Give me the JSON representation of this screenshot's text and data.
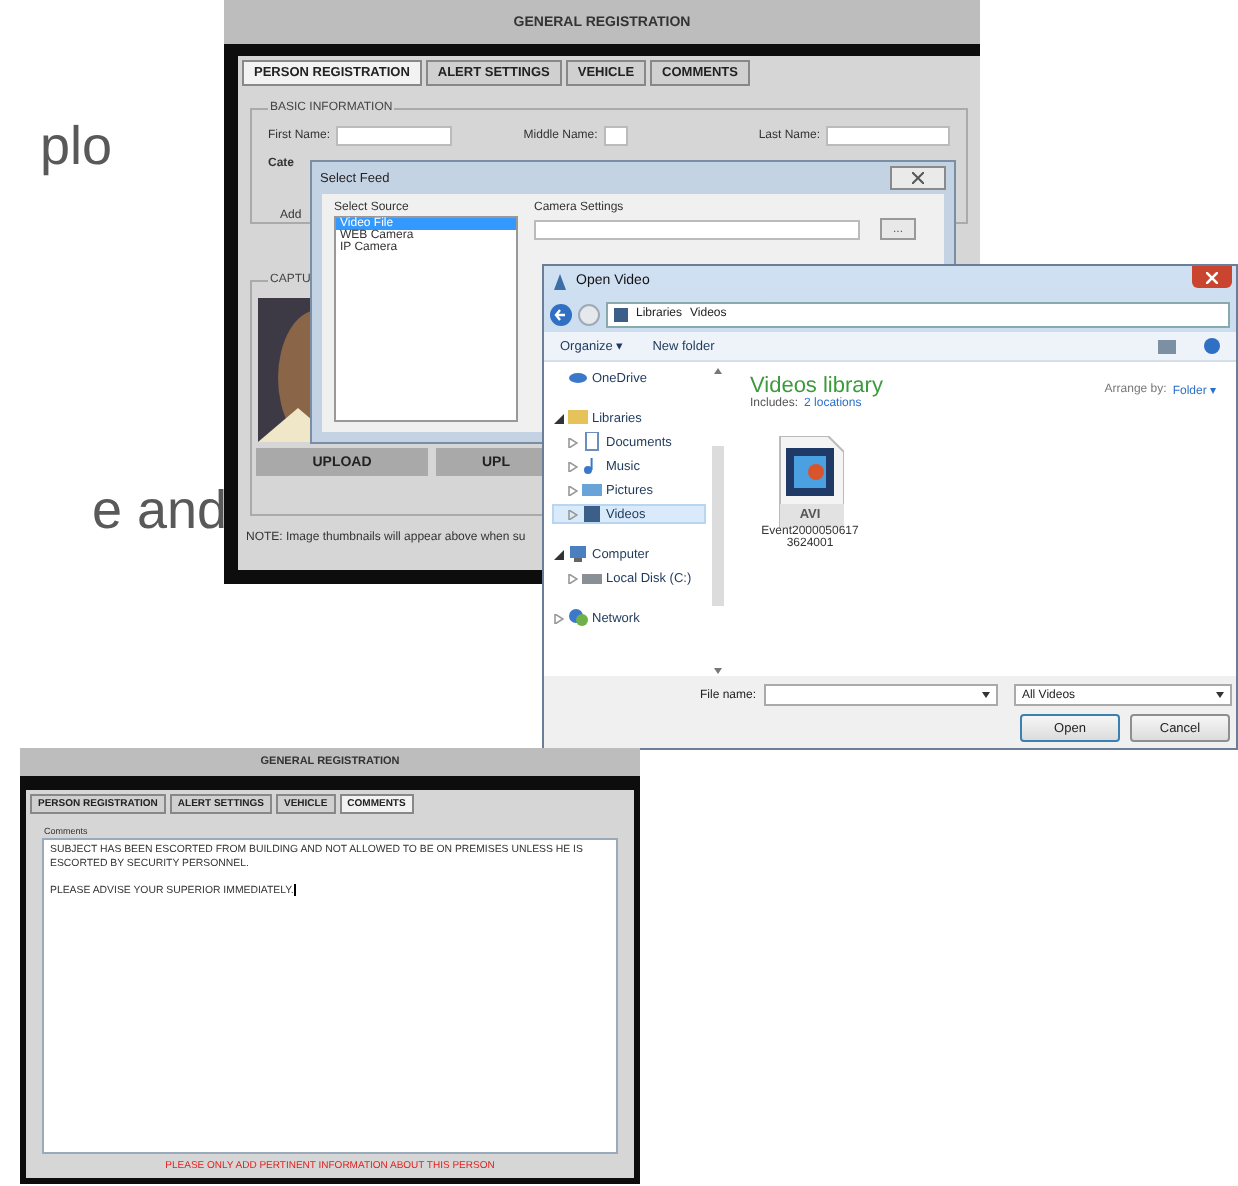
{
  "slide_text": [
    "plo",
    "e and"
  ],
  "registration_window": {
    "title": "GENERAL REGISTRATION",
    "tabs": [
      {
        "label": "PERSON REGISTRATION",
        "selected": true
      },
      {
        "label": "ALERT SETTINGS",
        "selected": false
      },
      {
        "label": "VEHICLE",
        "selected": false
      },
      {
        "label": "COMMENTS",
        "selected": false
      }
    ],
    "group_title": "BASIC INFORMATION",
    "fields": [
      {
        "label": "First Name:"
      },
      {
        "label": "Middle Name:"
      },
      {
        "label": "Last Name:"
      }
    ],
    "category_label": "Cate",
    "address_label": "Add",
    "capture_title": "CAPTU",
    "upload_buttons": [
      "UPLOAD",
      "UPL"
    ],
    "note": "NOTE: Image thumbnails will appear above when su"
  },
  "select_feed": {
    "title": "Select Feed",
    "source_label": "Select Source",
    "sources": [
      {
        "label": "Video File",
        "selected": true
      },
      {
        "label": "WEB Camera",
        "selected": false
      },
      {
        "label": "IP Camera",
        "selected": false
      }
    ],
    "camera_settings_label": "Camera Settings",
    "browse": "..."
  },
  "open_video": {
    "title": "Open Video",
    "path": [
      "Libraries",
      "Videos"
    ],
    "toolbar": [
      "Organize ▾",
      "New folder"
    ],
    "nav": [
      {
        "label": "OneDrive",
        "kind": "cloud",
        "selected": false
      },
      {
        "label": "Libraries",
        "kind": "library",
        "expanded": true,
        "selected": false,
        "children": [
          {
            "label": "Documents",
            "kind": "document",
            "expanded": false,
            "selected": false
          },
          {
            "label": "Music",
            "kind": "music",
            "expanded": false,
            "selected": false
          },
          {
            "label": "Pictures",
            "kind": "pictures",
            "expanded": false,
            "selected": false
          },
          {
            "label": "Videos",
            "kind": "video",
            "expanded": false,
            "selected": true
          }
        ]
      },
      {
        "label": "Computer",
        "kind": "computer",
        "expanded": true,
        "selected": false,
        "children": [
          {
            "label": "Local Disk (C:)",
            "kind": "disk",
            "expanded": false,
            "selected": false
          }
        ]
      },
      {
        "label": "Network",
        "kind": "network",
        "expanded": false,
        "selected": false
      }
    ],
    "library_title": "Videos library",
    "includes_label": "Includes:",
    "includes_link": "2 locations",
    "arrange_label": "Arrange by:",
    "arrange_value": "Folder ▾",
    "files": [
      {
        "badge": "AVI",
        "name": "Event2000050617\n3624001"
      }
    ],
    "file_name_label": "File name:",
    "file_type": "All Videos",
    "buttons": [
      "Open",
      "Cancel"
    ]
  },
  "comments_window": {
    "title": "GENERAL REGISTRATION",
    "tabs": [
      {
        "label": "PERSON REGISTRATION",
        "selected": false
      },
      {
        "label": "ALERT SETTINGS",
        "selected": false
      },
      {
        "label": "VEHICLE",
        "selected": false
      },
      {
        "label": "COMMENTS",
        "selected": true
      }
    ],
    "comments_label": "Comments",
    "value": "SUBJECT HAS BEEN ESCORTED FROM BUILDING AND NOT ALLOWED TO BE ON PREMISES UNLESS HE IS ESCORTED BY SECURITY PERSONNEL.\n\nPLEASE ADVISE YOUR SUPERIOR IMMEDIATELY.",
    "warning": "PLEASE ONLY ADD PERTINENT INFORMATION ABOUT THIS PERSON"
  }
}
